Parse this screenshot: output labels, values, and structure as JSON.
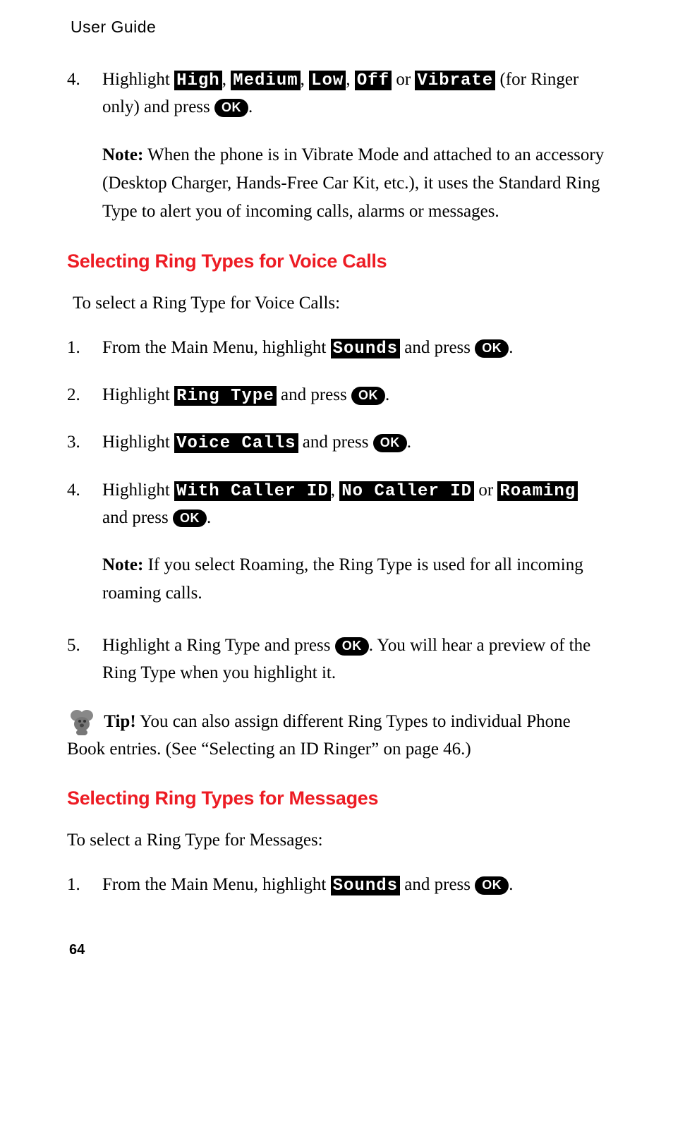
{
  "running_header": "User Guide",
  "page_number": "64",
  "ok_label": "OK",
  "top_item": {
    "number": "4.",
    "pre": "Highlight ",
    "opts": [
      "High",
      "Medium",
      "Low",
      "Off",
      "Vibrate"
    ],
    "mid": " (for Ringer only) and press ",
    "end": "."
  },
  "note1": {
    "label": "Note:",
    "text": " When the phone is in Vibrate Mode and attached to an accessory (Desktop Charger, Hands-Free Car Kit, etc.), it uses the Standard Ring Type to alert you of incoming calls, alarms or messages."
  },
  "section1": {
    "heading": "Selecting Ring Types for Voice Calls",
    "intro": "To select a Ring Type for Voice Calls:",
    "items": [
      {
        "number": "1.",
        "pre": "From the Main Menu, highlight ",
        "lcd": "Sounds",
        "mid": " and press ",
        "end": "."
      },
      {
        "number": "2.",
        "pre": "Highlight ",
        "lcd": "Ring Type",
        "mid": " and press ",
        "end": "."
      },
      {
        "number": "3.",
        "pre": "Highlight ",
        "lcd": "Voice Calls",
        "mid": " and press ",
        "end": "."
      }
    ],
    "item4": {
      "number": "4.",
      "pre": "Highlight ",
      "lcd_a": "With Caller ID",
      "sep": ", ",
      "lcd_b": "No Caller ID",
      "or": " or ",
      "lcd_c": "Roaming",
      "mid": " and press ",
      "end": "."
    },
    "note2": {
      "label": "Note:",
      "text": " If you select Roaming, the Ring Type is used for all incoming roaming calls."
    },
    "item5": {
      "number": "5.",
      "pre": "Highlight a Ring Type and press ",
      "post": ". You will hear a preview of the Ring Type when you highlight it."
    },
    "tip": {
      "label": "Tip!",
      "text": " You can also assign different Ring Types to individual Phone Book entries. (See “Selecting an ID Ringer” on page 46.)"
    }
  },
  "section2": {
    "heading": "Selecting Ring Types for Messages",
    "intro": "To select a Ring Type for Messages:",
    "items": [
      {
        "number": "1.",
        "pre": "From the Main Menu, highlight ",
        "lcd": "Sounds",
        "mid": " and press ",
        "end": "."
      }
    ]
  }
}
